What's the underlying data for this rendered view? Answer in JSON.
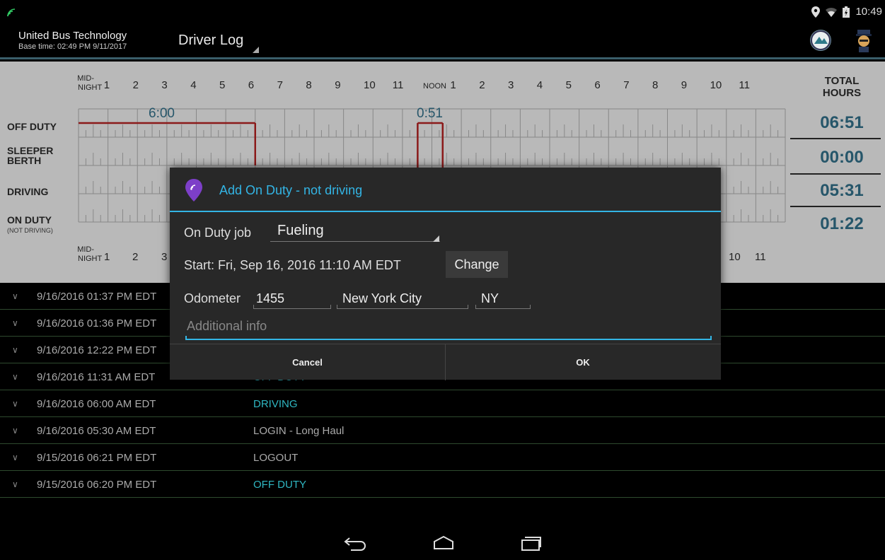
{
  "status_bar": {
    "time": "10:49"
  },
  "action_bar": {
    "app_name": "United Bus Technology",
    "base_time": "Base time: 02:49 PM 9/11/2017",
    "screen_title": "Driver Log"
  },
  "graph": {
    "mid_line1": "MID-",
    "mid_line2": "NIGHT",
    "noon": "NOON",
    "hours": [
      "1",
      "2",
      "3",
      "4",
      "5",
      "6",
      "7",
      "8",
      "9",
      "10",
      "11",
      "1",
      "2",
      "3",
      "4",
      "5",
      "6",
      "7",
      "8",
      "9",
      "10",
      "11"
    ],
    "rows": {
      "off_duty": "OFF DUTY",
      "sleeper_1": "SLEEPER",
      "sleeper_2": "BERTH",
      "driving": "DRIVING",
      "on_duty": "ON DUTY",
      "on_duty_sub": "(NOT DRIVING)"
    },
    "annotations": {
      "off_duty_1": "6:00",
      "off_duty_2": "0:51"
    },
    "total_header_1": "TOTAL",
    "total_header_2": "HOURS",
    "totals": {
      "off_duty": "06:51",
      "sleeper": "00:00",
      "driving": "05:31",
      "on_duty": "01:22"
    },
    "bottom_hours_visible": [
      "1",
      "2",
      "3",
      "10",
      "11"
    ]
  },
  "events": [
    {
      "timestamp": "9/16/2016 01:37 PM EDT",
      "event": "",
      "color": "teal"
    },
    {
      "timestamp": "9/16/2016 01:36 PM EDT",
      "event": "",
      "color": "teal"
    },
    {
      "timestamp": "9/16/2016 12:22 PM EDT",
      "event": "",
      "color": "teal"
    },
    {
      "timestamp": "9/16/2016 11:31 AM EDT",
      "event": "OFF DUTY",
      "color": "teal"
    },
    {
      "timestamp": "9/16/2016 06:00 AM EDT",
      "event": "DRIVING",
      "color": "teal"
    },
    {
      "timestamp": "9/16/2016 05:30 AM EDT",
      "event": "LOGIN - Long Haul",
      "color": "gray"
    },
    {
      "timestamp": "9/15/2016 06:21 PM EDT",
      "event": "LOGOUT",
      "color": "gray"
    },
    {
      "timestamp": "9/15/2016 06:20 PM EDT",
      "event": "OFF DUTY",
      "color": "teal"
    }
  ],
  "dialog": {
    "title": "Add On Duty - not driving",
    "job_label": "On Duty job",
    "job_value": "Fueling",
    "start_text": "Start: Fri, Sep 16, 2016 11:10 AM EDT",
    "change_label": "Change",
    "odometer_label": "Odometer",
    "odometer_value": "1455",
    "city_value": "New York City",
    "state_value": "NY",
    "additional_placeholder": "Additional info",
    "cancel_label": "Cancel",
    "ok_label": "OK"
  },
  "colors": {
    "accent": "#33b5e5",
    "teal_event": "#2fb7c2",
    "total_value": "#26566a",
    "graph_line": "#8b1a1a",
    "graph_bg": "#b9b9b9"
  }
}
